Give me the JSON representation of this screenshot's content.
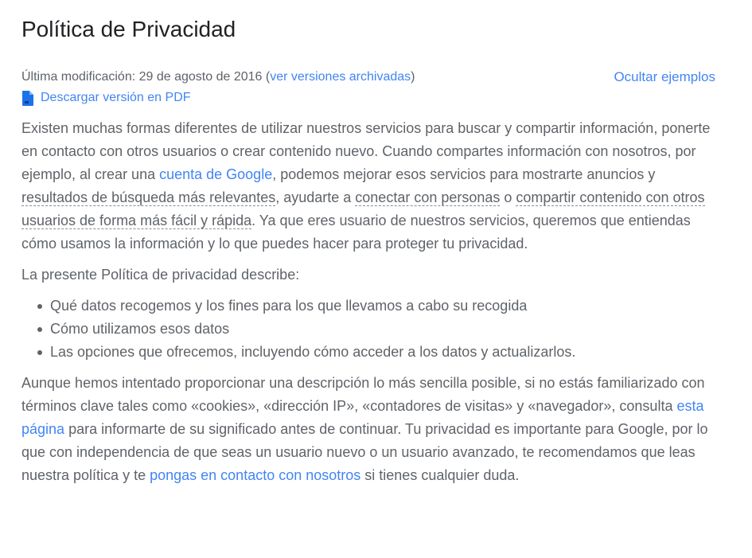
{
  "title": "Política de Privacidad",
  "meta": {
    "modified_prefix": "Última modificación: 29 de agosto de 2016 (",
    "archived_link": "ver versiones archivadas",
    "modified_suffix": ")",
    "hide_examples": "Ocultar ejemplos",
    "pdf_link": "Descargar versión en PDF",
    "pdf_icon": "document-icon"
  },
  "intro": {
    "t1": "Existen muchas formas diferentes de utilizar nuestros servicios para buscar y compartir información, ponerte en contacto con otros usuarios o crear contenido nuevo. Cuando compartes información con nosotros, por ejemplo, al crear una ",
    "link_account": "cuenta de Google",
    "t2": ", podemos mejorar esos servicios para mostrarte anuncios y ",
    "ex_results": "resultados de búsqueda más relevantes",
    "t3": ", ayudarte a ",
    "ex_connect": "conectar con personas",
    "t4": " o ",
    "ex_share": "compartir contenido con otros usuarios de forma más fácil y rápida",
    "t5": ". Ya que eres usuario de nuestros servicios, queremos que entiendas cómo usamos la información y lo que puedes hacer para proteger tu privacidad."
  },
  "describe_heading": "La presente Política de privacidad describe:",
  "describe_items": [
    "Qué datos recogemos y los fines para los que llevamos a cabo su recogida",
    "Cómo utilizamos esos datos",
    "Las opciones que ofrecemos, incluyendo cómo acceder a los datos y actualizarlos."
  ],
  "closing": {
    "t1": "Aunque hemos intentado proporcionar una descripción lo más sencilla posible, si no estás familiarizado con términos clave tales como «cookies», «dirección IP», «contadores de visitas» y «navegador», consulta ",
    "link_page": "esta página",
    "t2": " para informarte de su significado antes de continuar. Tu privacidad es importante para Google, por lo que con independencia de que seas un usuario nuevo o un usuario avanzado, te recomendamos que leas nuestra política y te ",
    "link_contact": "pongas en contacto con nosotros",
    "t3": " si tienes cualquier duda."
  },
  "colors": {
    "link": "#4285f4",
    "text": "#5f6368",
    "title": "#202124",
    "pdf_icon": "#1a73e8"
  }
}
